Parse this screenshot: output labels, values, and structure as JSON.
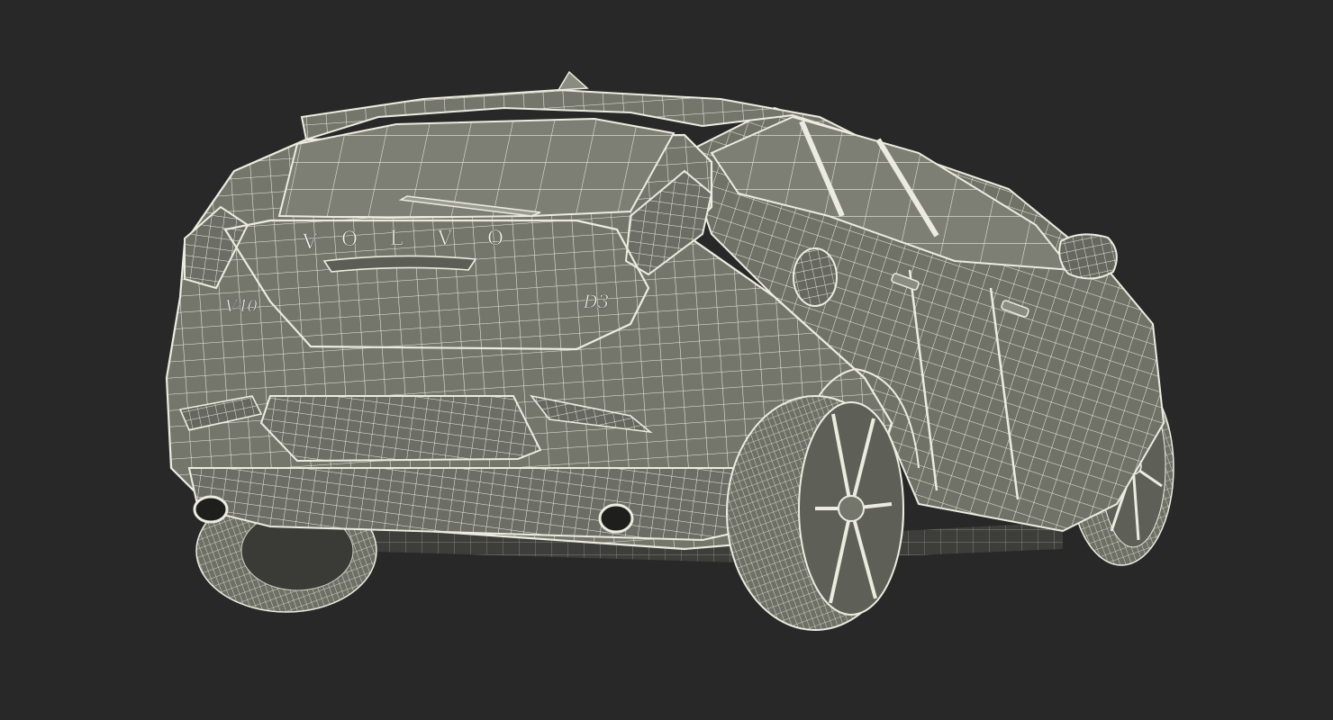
{
  "scene": {
    "subject": "car-wireframe-render",
    "view": "rear-three-quarter",
    "colors": {
      "background": "#282828",
      "surface": "#74766c",
      "surface_dark": "#5c5e56",
      "surface_light": "#8a8c82",
      "wire": "#ecebdf",
      "shadow": "#1e1e1c"
    }
  },
  "badges": {
    "brand_letters": [
      "V",
      "O",
      "L",
      "V",
      "O"
    ],
    "model": "V40",
    "trim": "D3"
  }
}
